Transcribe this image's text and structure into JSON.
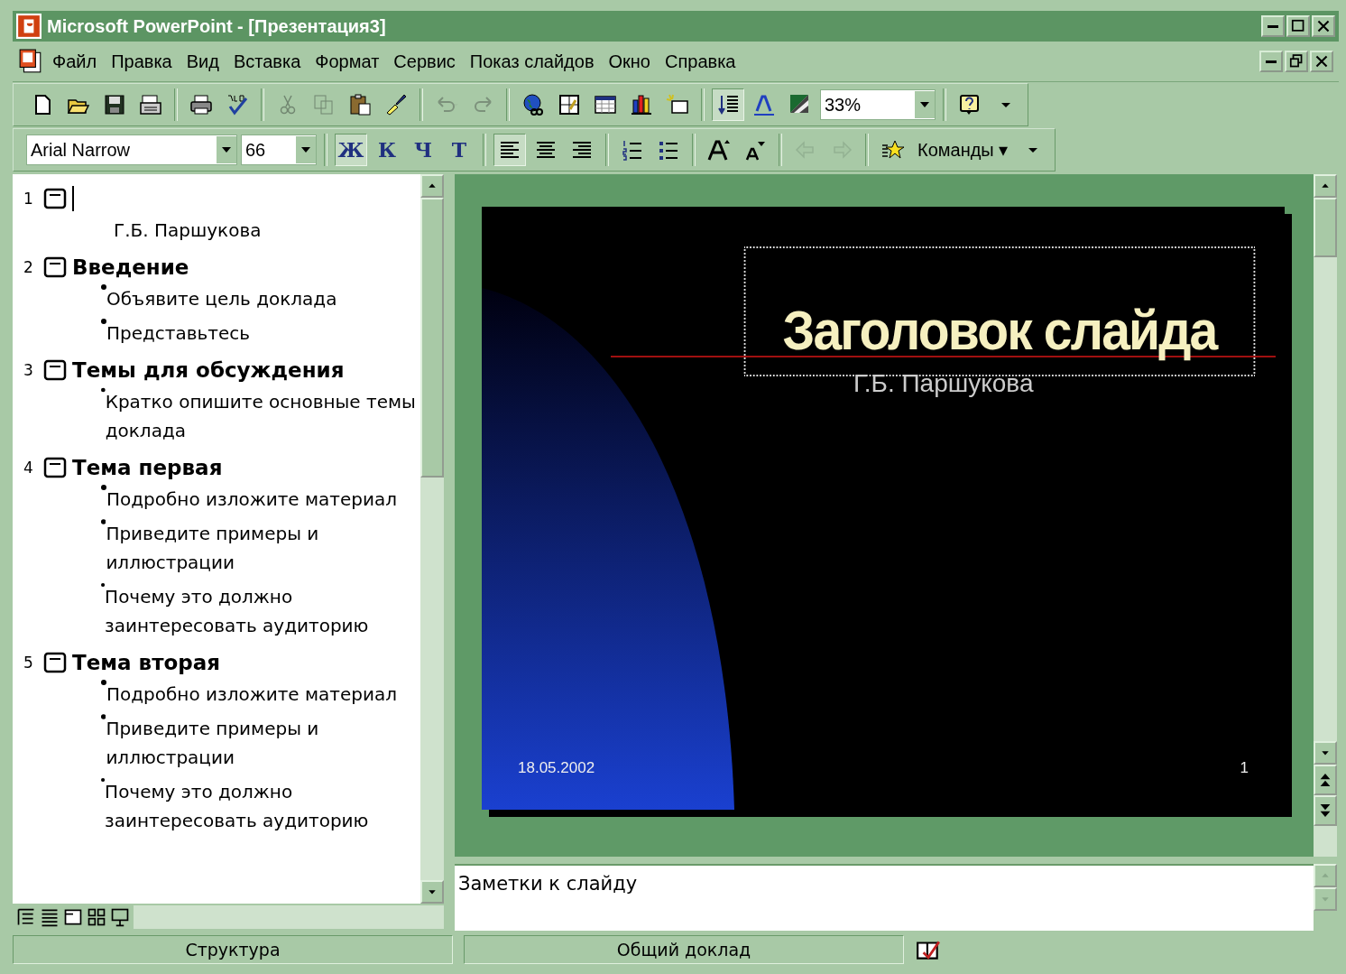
{
  "window": {
    "title": "Microsoft PowerPoint - [Презентация3]"
  },
  "menu": [
    "Файл",
    "Правка",
    "Вид",
    "Вставка",
    "Формат",
    "Сервис",
    "Показ слайдов",
    "Окно",
    "Справка"
  ],
  "standard_toolbar": [
    {
      "kind": "new",
      "disabled": false
    },
    {
      "kind": "open",
      "disabled": false
    },
    {
      "kind": "save",
      "disabled": false
    },
    {
      "kind": "email",
      "disabled": false
    },
    {
      "kind": "sep"
    },
    {
      "kind": "print",
      "disabled": false
    },
    {
      "kind": "spell",
      "disabled": false
    },
    {
      "kind": "sep"
    },
    {
      "kind": "cut",
      "disabled": true
    },
    {
      "kind": "copy",
      "disabled": true
    },
    {
      "kind": "paste",
      "disabled": false
    },
    {
      "kind": "brush",
      "disabled": false
    },
    {
      "kind": "sep"
    },
    {
      "kind": "undo",
      "disabled": true
    },
    {
      "kind": "redo",
      "disabled": true
    },
    {
      "kind": "sep"
    },
    {
      "kind": "web",
      "disabled": false
    },
    {
      "kind": "insert-table",
      "disabled": false
    },
    {
      "kind": "table",
      "disabled": false
    },
    {
      "kind": "chart",
      "disabled": false
    },
    {
      "kind": "new-slide",
      "disabled": false
    },
    {
      "kind": "sep"
    },
    {
      "kind": "expand",
      "disabled": false,
      "pressed": true
    },
    {
      "kind": "font-color",
      "disabled": false
    },
    {
      "kind": "grayscale",
      "disabled": false
    },
    {
      "kind": "combo",
      "value": "33%"
    },
    {
      "kind": "sep"
    },
    {
      "kind": "help",
      "disabled": false
    },
    {
      "kind": "chevron"
    }
  ],
  "format_toolbar": [
    {
      "kind": "combo",
      "value": "Arial Narrow"
    },
    {
      "kind": "combo",
      "value": "66"
    },
    {
      "kind": "sep"
    },
    {
      "kind": "text",
      "label": "Ж",
      "pressed": true
    },
    {
      "kind": "text",
      "label": "К",
      "pressed": false
    },
    {
      "kind": "text",
      "label": "Ч",
      "pressed": false
    },
    {
      "kind": "text",
      "label": "Т",
      "pressed": false
    },
    {
      "kind": "sep"
    },
    {
      "kind": "align-left",
      "pressed": true
    },
    {
      "kind": "align-center",
      "pressed": false
    },
    {
      "kind": "align-right",
      "pressed": false
    },
    {
      "kind": "sep"
    },
    {
      "kind": "numbering",
      "pressed": false
    },
    {
      "kind": "bullets",
      "pressed": false
    },
    {
      "kind": "sep"
    },
    {
      "kind": "grow-font",
      "pressed": false
    },
    {
      "kind": "shrink-font",
      "pressed": false
    },
    {
      "kind": "sep"
    },
    {
      "kind": "promote",
      "disabled": true
    },
    {
      "kind": "demote",
      "disabled": true
    },
    {
      "kind": "sep"
    },
    {
      "kind": "animation"
    },
    {
      "kind": "menu-button",
      "label": "Команды",
      "caret": "▾"
    },
    {
      "kind": "chevron"
    }
  ],
  "outline": [
    {
      "number": "1",
      "cursor": true,
      "lines": [
        {
          "kind": "plain",
          "text": "Г.Б. Паршукова"
        }
      ]
    },
    {
      "number": "2",
      "title": "Введение",
      "cursor": false,
      "lines": [
        {
          "kind": "bullet",
          "text": "Объявите цель доклада"
        },
        {
          "kind": "bullet",
          "text": "Представьтесь"
        }
      ]
    },
    {
      "number": "3",
      "title": "Темы для обсуждения",
      "cursor": false,
      "lines": [
        {
          "kind": "bullet",
          "text": "Кратко опишите основные темы доклада"
        }
      ]
    },
    {
      "number": "4",
      "title": "Тема первая",
      "cursor": false,
      "lines": [
        {
          "kind": "bullet",
          "text": "Подробно изложите материал"
        },
        {
          "kind": "bullet",
          "text": "Приведите примеры и иллюстрации"
        },
        {
          "kind": "bullet",
          "text": "Почему это должно заинтересовать аудиторию"
        }
      ]
    },
    {
      "number": "5",
      "title": "Тема вторая",
      "cursor": false,
      "lines": [
        {
          "kind": "bullet",
          "text": "Подробно изложите материал"
        },
        {
          "kind": "bullet",
          "text": "Приведите примеры и иллюстрации"
        },
        {
          "kind": "bullet",
          "text": "Почему это должно заинтересовать аудиторию"
        }
      ]
    }
  ],
  "slide": {
    "title": "Заголовок слайда",
    "subtitle": "Г.Б. Паршукова",
    "date": "18.05.2002",
    "number": "1"
  },
  "notes": {
    "placeholder": "Заметки к слайду"
  },
  "status_bar": [
    "Структура",
    "Общий доклад"
  ]
}
